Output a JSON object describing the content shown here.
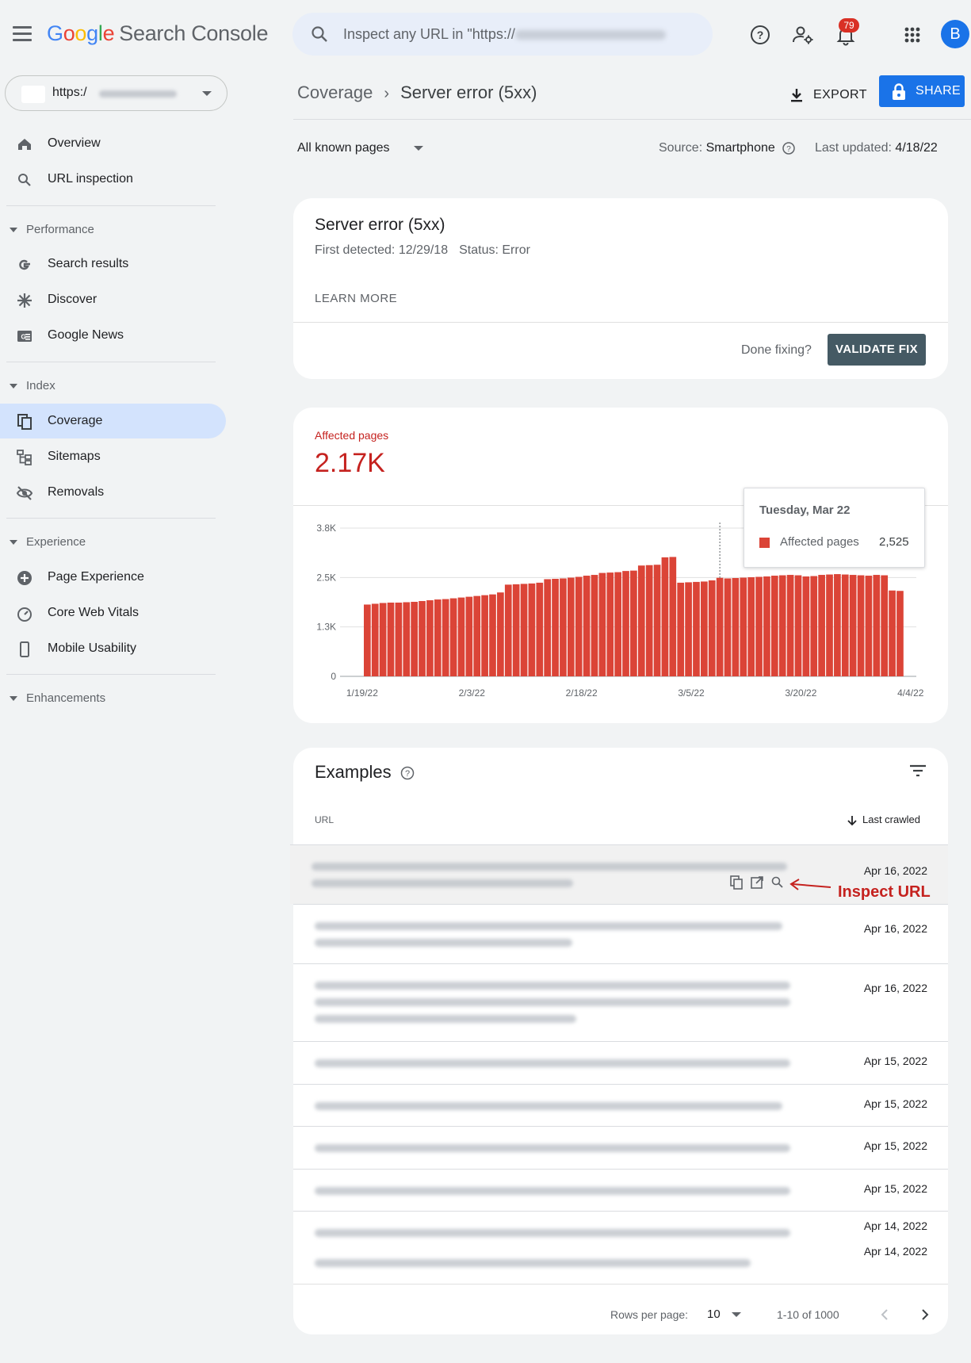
{
  "app": {
    "logo_letters": [
      "G",
      "o",
      "o",
      "g",
      "l",
      "e"
    ],
    "product_name": "Search Console"
  },
  "search": {
    "placeholder": "Inspect any URL in \"https://"
  },
  "notifications": {
    "count": "79"
  },
  "account": {
    "initial": "B"
  },
  "property": {
    "prefix": "https:/"
  },
  "sidebar": {
    "top_items": [
      {
        "label": "Overview",
        "icon": "home-icon"
      },
      {
        "label": "URL inspection",
        "icon": "search-icon"
      }
    ],
    "sections": [
      {
        "title": "Performance",
        "items": [
          {
            "label": "Search results",
            "icon": "google-g-icon"
          },
          {
            "label": "Discover",
            "icon": "asterisk-icon"
          },
          {
            "label": "Google News",
            "icon": "news-icon"
          }
        ]
      },
      {
        "title": "Index",
        "items": [
          {
            "label": "Coverage",
            "icon": "pages-icon",
            "active": true
          },
          {
            "label": "Sitemaps",
            "icon": "sitemap-icon"
          },
          {
            "label": "Removals",
            "icon": "eye-off-icon"
          }
        ]
      },
      {
        "title": "Experience",
        "items": [
          {
            "label": "Page Experience",
            "icon": "plus-circle-icon"
          },
          {
            "label": "Core Web Vitals",
            "icon": "gauge-icon"
          },
          {
            "label": "Mobile Usability",
            "icon": "phone-icon"
          }
        ]
      },
      {
        "title": "Enhancements",
        "items": []
      }
    ]
  },
  "header": {
    "breadcrumb_parent": "Coverage",
    "breadcrumb_current": "Server error (5xx)",
    "export_label": "EXPORT",
    "share_label": "SHARE"
  },
  "filters": {
    "pages_selected": "All known pages",
    "source_label": "Source:",
    "source_value": "Smartphone",
    "updated_label": "Last updated:",
    "updated_value": "4/18/22"
  },
  "issue": {
    "title": "Server error (5xx)",
    "first_detected": "First detected: 12/29/18",
    "status": "Status: Error",
    "learn_more": "LEARN MORE",
    "done_fixing": "Done fixing?",
    "validate_label": "VALIDATE FIX"
  },
  "affected": {
    "label": "Affected pages",
    "value": "2.17K"
  },
  "chart_data": {
    "type": "bar",
    "series": [
      {
        "name": "Affected pages",
        "color": "#db4437",
        "values": [
          1840,
          1860,
          1880,
          1890,
          1890,
          1900,
          1910,
          1930,
          1950,
          1970,
          1980,
          2000,
          2020,
          2040,
          2060,
          2080,
          2100,
          2150,
          2350,
          2360,
          2370,
          2380,
          2400,
          2490,
          2500,
          2510,
          2530,
          2550,
          2580,
          2600,
          2650,
          2660,
          2670,
          2700,
          2710,
          2840,
          2850,
          2860,
          3050,
          3060,
          2400,
          2410,
          2420,
          2430,
          2460,
          2525,
          2510,
          2520,
          2530,
          2540,
          2550,
          2560,
          2580,
          2590,
          2600,
          2590,
          2560,
          2570,
          2600,
          2610,
          2620,
          2610,
          2600,
          2590,
          2580,
          2600,
          2590,
          2200,
          2190
        ]
      }
    ],
    "x_ticks": [
      "1/19/22",
      "2/3/22",
      "2/18/22",
      "3/5/22",
      "3/20/22",
      "4/4/22"
    ],
    "y_ticks": [
      "0",
      "1.3K",
      "2.5K",
      "3.8K"
    ],
    "ylim": [
      0,
      3800
    ],
    "grid": true,
    "highlight_index": 45
  },
  "tooltip": {
    "date": "Tuesday, Mar 22",
    "label": "Affected pages",
    "value": "2,525"
  },
  "examples": {
    "title": "Examples",
    "col_url": "URL",
    "col_crawled": "Last crawled",
    "rows": [
      {
        "date": "Apr 16, 2022",
        "highlighted": true
      },
      {
        "date": "Apr 16, 2022"
      },
      {
        "date": "Apr 16, 2022"
      },
      {
        "date": "Apr 15, 2022"
      },
      {
        "date": "Apr 15, 2022"
      },
      {
        "date": "Apr 15, 2022"
      },
      {
        "date": "Apr 15, 2022"
      },
      {
        "date": "Apr 14, 2022"
      },
      {
        "date": "Apr 14, 2022"
      }
    ],
    "annotation": "Inspect URL",
    "rows_per_page_label": "Rows per page:",
    "rows_per_page_value": "10",
    "range": "1-10 of 1000"
  }
}
